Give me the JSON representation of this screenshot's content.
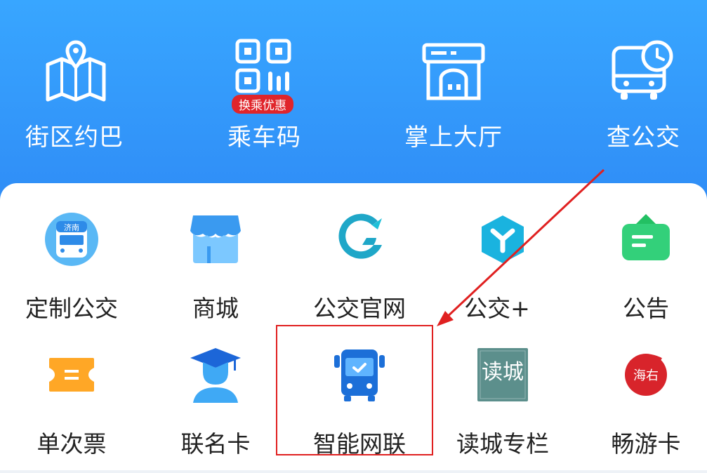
{
  "top_row": [
    {
      "label": "街区约巴",
      "icon": "map-pin-icon"
    },
    {
      "label": "乘车码",
      "icon": "qr-code-icon",
      "badge": "换乘优惠"
    },
    {
      "label": "掌上大厅",
      "icon": "hall-building-icon"
    },
    {
      "label": "查公交",
      "icon": "bus-clock-icon"
    }
  ],
  "grid_row1": [
    {
      "label": "定制公交",
      "icon": "custom-bus-icon"
    },
    {
      "label": "商城",
      "icon": "shop-icon"
    },
    {
      "label": "公交官网",
      "icon": "website-logo-icon"
    },
    {
      "label": "公交+",
      "icon": "bus-plus-icon"
    },
    {
      "label": "公告",
      "icon": "notice-icon"
    }
  ],
  "grid_row2": [
    {
      "label": "单次票",
      "icon": "ticket-icon"
    },
    {
      "label": "联名卡",
      "icon": "graduate-card-icon"
    },
    {
      "label": "智能网联",
      "icon": "smart-bus-icon"
    },
    {
      "label": "读城专栏",
      "icon": "reading-city-icon"
    },
    {
      "label": "畅游卡",
      "icon": "travel-card-icon"
    }
  ],
  "custom_bus_icon_text": "济南",
  "reading_city_icon_text": "读城",
  "travel_card_icon_text": "海右",
  "colors": {
    "hero_top": "#38a6ff",
    "hero_bottom": "#2f8cf6",
    "badge": "#e0252b",
    "highlight": "#e02020"
  }
}
